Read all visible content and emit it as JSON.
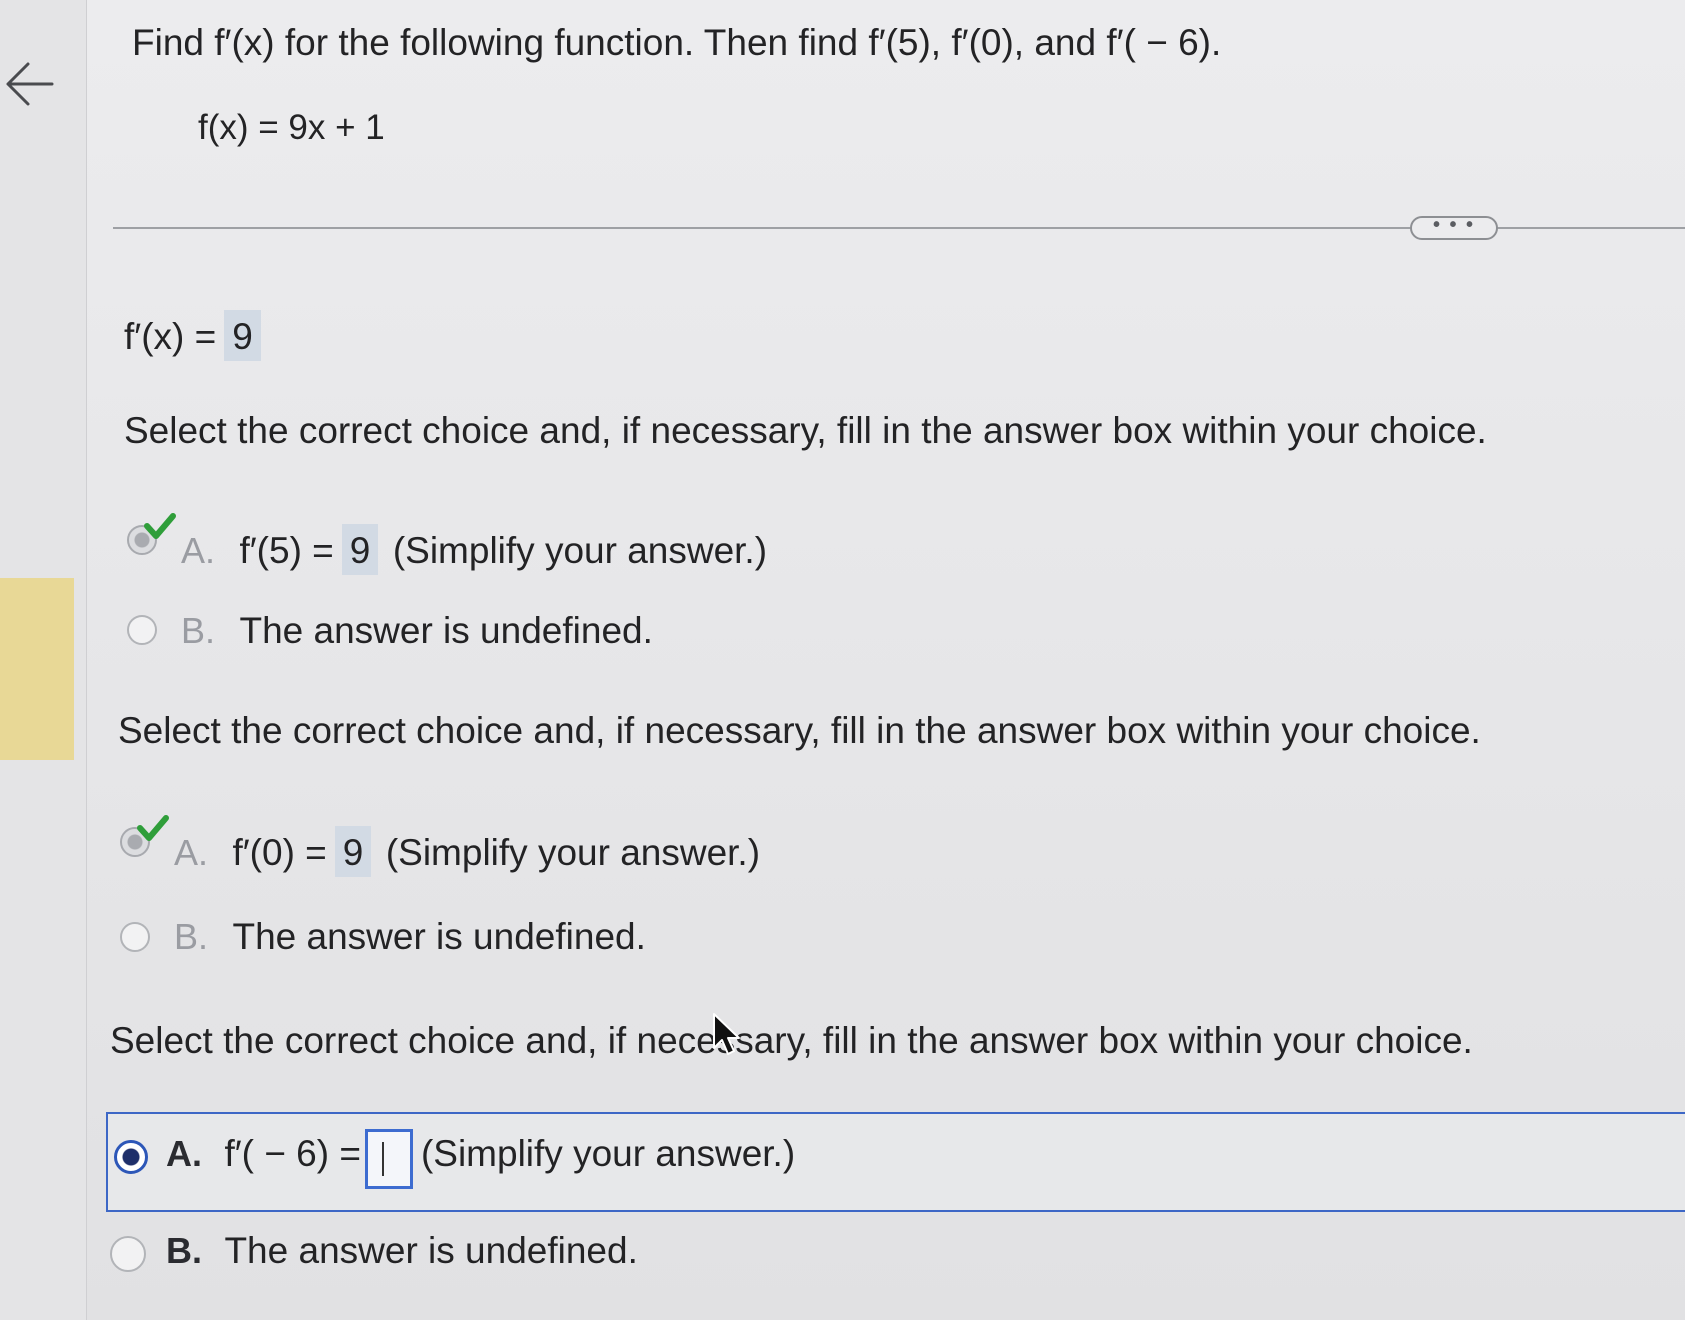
{
  "question": {
    "prompt": "Find f′(x) for the following function. Then find f′(5), f′(0), and f′( − 6).",
    "function": "f(x) = 9x + 1"
  },
  "more_button": {
    "label": "• • •"
  },
  "derivative": {
    "label": "f′(x) =",
    "value": "9"
  },
  "parts": [
    {
      "instruction": "Select the correct choice and, if necessary, fill in the answer box within your choice.",
      "choice_a": {
        "letter": "A.",
        "expr": "f′(5) =",
        "answer": "9",
        "hint": "(Simplify your answer.)",
        "state": "correct"
      },
      "choice_b": {
        "letter": "B.",
        "text": "The answer is undefined.",
        "state": "unselected"
      }
    },
    {
      "instruction": "Select the correct choice and, if necessary, fill in the answer box within your choice.",
      "choice_a": {
        "letter": "A.",
        "expr": "f′(0) =",
        "answer": "9",
        "hint": "(Simplify your answer.)",
        "state": "correct"
      },
      "choice_b": {
        "letter": "B.",
        "text": "The answer is undefined.",
        "state": "unselected"
      }
    },
    {
      "instruction": "Select the correct choice and, if necessary, fill in the answer box within your choice.",
      "choice_a": {
        "letter": "A.",
        "expr": "f′( − 6) =",
        "answer": "",
        "hint": "(Simplify your answer.)",
        "state": "selected"
      },
      "choice_b": {
        "letter": "B.",
        "text": "The answer is undefined.",
        "state": "unselected"
      }
    }
  ],
  "colors": {
    "accent_blue": "#3d67c6",
    "check_green": "#2f9e3a",
    "answer_box_fill": "#d2dae4",
    "sidebar_highlight": "#e8d896"
  },
  "icons": [
    "back-arrow-icon",
    "check-icon",
    "radio-icon",
    "mouse-pointer-icon"
  ]
}
